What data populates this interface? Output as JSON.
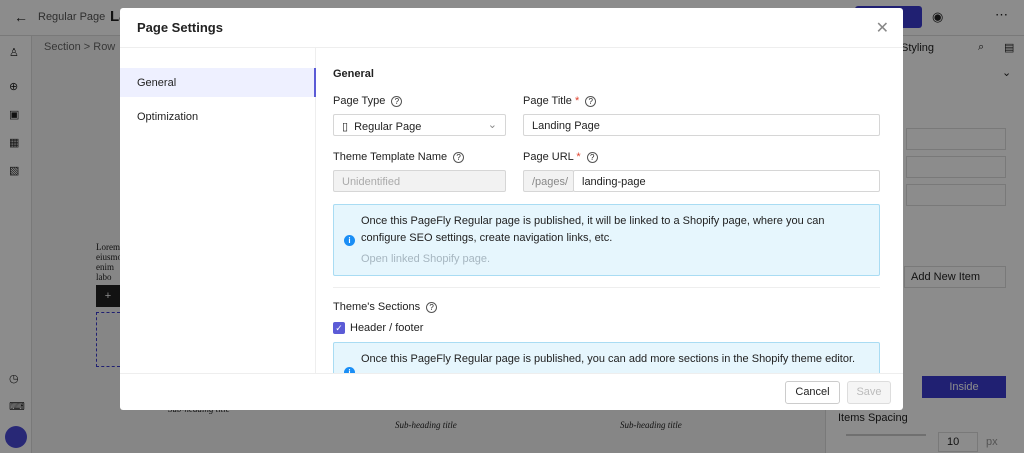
{
  "editor": {
    "back_label": "Regular Page",
    "page_name": "Landing Page",
    "breadcrumb": [
      "Section",
      "Row"
    ],
    "styling_tab": "Styling",
    "add_new_item": "Add New Item",
    "inside_button": "Inside",
    "items_spacing_label": "Items Spacing",
    "items_spacing_value": "10",
    "items_spacing_unit": "px",
    "canvas_subheading": "Sub-heading title",
    "canvas_lorem": "Lorem eiusmo enim labo"
  },
  "modal": {
    "title": "Page Settings",
    "nav": [
      {
        "label": "General"
      },
      {
        "label": "Optimization"
      }
    ],
    "section_title": "General",
    "page_type": {
      "label": "Page Type",
      "value": "Regular Page"
    },
    "page_title": {
      "label": "Page Title",
      "value": "Landing Page"
    },
    "theme_template": {
      "label": "Theme Template Name",
      "placeholder": "Unidentified"
    },
    "page_url": {
      "label": "Page URL",
      "prefix": "/pages/",
      "value": "landing-page"
    },
    "info1": {
      "text": "Once this PageFly Regular page is published, it will be linked to a Shopify page, where you can configure SEO settings, create navigation links, etc.",
      "link": "Open linked Shopify page."
    },
    "themes_sections": {
      "label": "Theme's Sections",
      "checkbox": "Header / footer",
      "checked": true
    },
    "info2": {
      "text": "Once this PageFly Regular page is published, you can add more sections in the Shopify theme editor."
    },
    "cancel": "Cancel",
    "save": "Save"
  }
}
